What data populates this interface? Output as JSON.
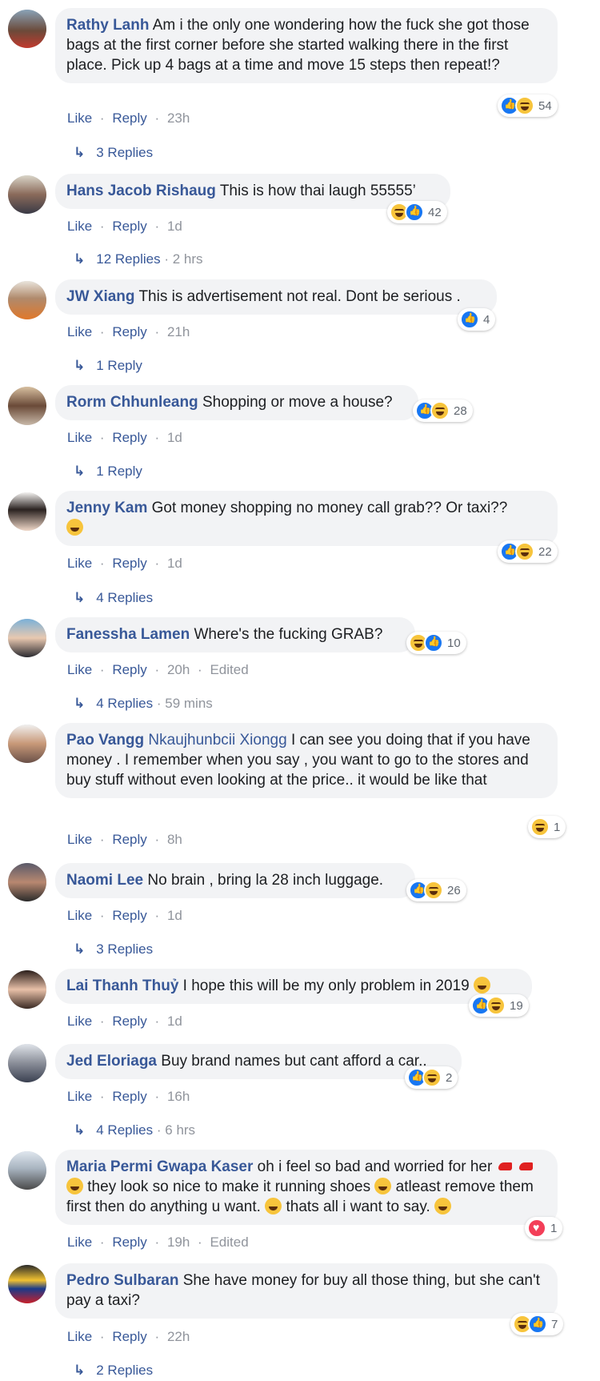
{
  "ui": {
    "like_label": "Like",
    "reply_label": "Reply",
    "separator": "·",
    "reply_arrow": "↳"
  },
  "comments": [
    {
      "author": "Rathy Lanh",
      "text": "Am i the only one wondering how the fuck she got those bags at the first corner before she started walking there in the first place. Pick up 4 bags at a time and move 15 steps then repeat!?",
      "reactions": [
        "like",
        "haha"
      ],
      "reaction_count": "54",
      "time": "23h",
      "edited": "",
      "replies": "3 Replies",
      "replies_time": ""
    },
    {
      "author": "Hans Jacob Rishaug",
      "text": "This is how thai laugh 55555’",
      "reactions": [
        "haha",
        "like"
      ],
      "reaction_count": "42",
      "time": "1d",
      "edited": "",
      "replies": "12 Replies",
      "replies_time": "2 hrs"
    },
    {
      "author": "JW Xiang",
      "text": "This is advertisement not real. Dont be serious .",
      "reactions": [
        "like"
      ],
      "reaction_count": "4",
      "time": "21h",
      "edited": "",
      "replies": "1 Reply",
      "replies_time": ""
    },
    {
      "author": "Rorm Chhunleang",
      "text": "Shopping or move a house?",
      "reactions": [
        "like",
        "haha"
      ],
      "reaction_count": "28",
      "time": "1d",
      "edited": "",
      "replies": "1 Reply",
      "replies_time": ""
    },
    {
      "author": "Jenny Kam",
      "text": "Got money shopping no money call grab?? Or taxi??",
      "reactions": [
        "like",
        "haha"
      ],
      "reaction_count": "22",
      "time": "1d",
      "edited": "",
      "replies": "4 Replies",
      "replies_time": ""
    },
    {
      "author": "Fanessha Lamen",
      "text": "Where's the fucking GRAB?",
      "reactions": [
        "haha",
        "like"
      ],
      "reaction_count": "10",
      "time": "20h",
      "edited": "Edited",
      "replies": "4 Replies",
      "replies_time": "59 mins"
    },
    {
      "author": "Pao Vangg",
      "tag": "Nkaujhunbcii Xiongg",
      "text": "I can see you doing that if you have money . I remember when you say , you want to go to the stores and buy stuff without even looking at the price.. it would be like that",
      "reactions": [
        "haha"
      ],
      "reaction_count": "1",
      "time": "8h",
      "edited": "",
      "replies": "",
      "replies_time": ""
    },
    {
      "author": "Naomi Lee",
      "text": "No brain , bring la 28 inch luggage.",
      "reactions": [
        "like",
        "haha"
      ],
      "reaction_count": "26",
      "time": "1d",
      "edited": "",
      "replies": "3 Replies",
      "replies_time": ""
    },
    {
      "author": "Lai Thanh Thuỷ",
      "text": "I hope this will be my only problem in 2019",
      "reactions": [
        "like",
        "haha"
      ],
      "reaction_count": "19",
      "time": "1d",
      "edited": "",
      "replies": "",
      "replies_time": ""
    },
    {
      "author": "Jed Eloriaga",
      "text": "Buy brand names but cant afford a car..",
      "reactions": [
        "like",
        "haha"
      ],
      "reaction_count": "2",
      "time": "16h",
      "edited": "",
      "replies": "4 Replies",
      "replies_time": "6 hrs"
    },
    {
      "author": "Maria Permi Gwapa Kaser",
      "text_a": "oh i feel so bad and worried for her",
      "text_b": "they look so nice to make it running shoes",
      "text_c": "atleast remove them first then do anything u want.",
      "text_d": "thats all i want to say.",
      "reactions": [
        "love"
      ],
      "reaction_count": "1",
      "time": "19h",
      "edited": "Edited",
      "replies": "",
      "replies_time": ""
    },
    {
      "author": "Pedro Sulbaran",
      "text": "She have money for buy all those thing, but she can't pay a taxi?",
      "reactions": [
        "haha",
        "like"
      ],
      "reaction_count": "7",
      "time": "22h",
      "edited": "",
      "replies": "2 Replies",
      "replies_time": ""
    }
  ],
  "colors": {
    "author": "#385898",
    "bubble": "#f2f3f5",
    "meta": "#90949c",
    "like_blue": "#1877f2",
    "haha_yellow": "#f7c43c",
    "love_red": "#f33e58"
  }
}
